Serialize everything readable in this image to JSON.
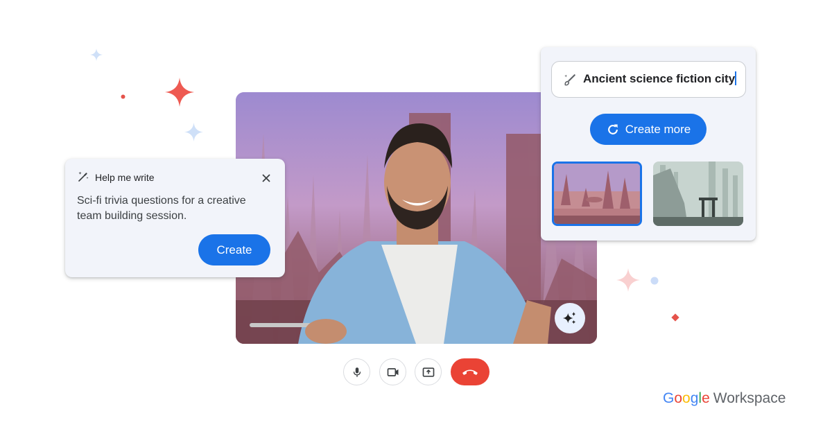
{
  "help_me_write": {
    "title": "Help me write",
    "prompt": "Sci-fi trivia questions for a creative team building session.",
    "create_label": "Create",
    "icons": {
      "pen": "magic-pen-icon",
      "close": "close-icon"
    }
  },
  "image_generator": {
    "prompt_value": "Ancient science fiction city",
    "create_more_label": "Create more",
    "icons": {
      "prompt": "magic-brush-icon",
      "refresh": "refresh-icon"
    },
    "thumbnails": [
      {
        "description": "Pink ancient sci-fi city with towers",
        "selected": true
      },
      {
        "description": "Grey-green misty sci-fi city ruins",
        "selected": false
      }
    ]
  },
  "call_controls": [
    {
      "name": "microphone",
      "icon": "mic-icon"
    },
    {
      "name": "camera",
      "icon": "video-camera-icon"
    },
    {
      "name": "present",
      "icon": "present-screen-icon"
    },
    {
      "name": "end-call",
      "icon": "hang-up-icon"
    }
  ],
  "effects_button": {
    "icon": "sparkle-effects-icon"
  },
  "brand": {
    "google_letters": [
      "G",
      "o",
      "o",
      "g",
      "l",
      "e"
    ],
    "product": "Workspace"
  },
  "colors": {
    "accent": "#1a73e8",
    "danger": "#ea4335",
    "card_bg": "#f2f4fa",
    "sparkle_red": "#ee5a52",
    "sparkle_blue": "#c9dcf7",
    "sparkle_pink": "#f9d0d0"
  }
}
